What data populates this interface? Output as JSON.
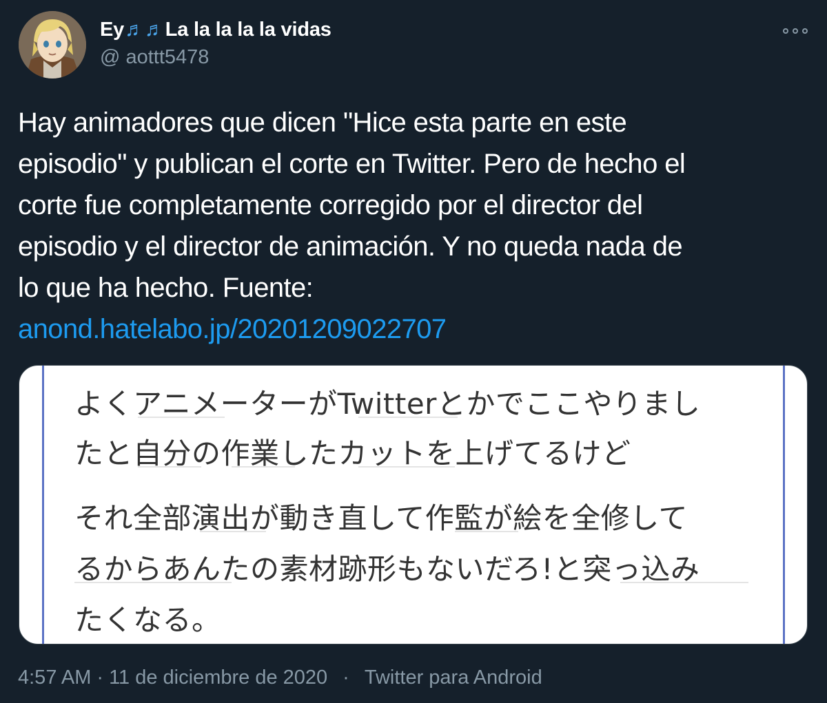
{
  "user": {
    "display_name_prefix": "Ey",
    "display_name_icon": "♬♬",
    "display_name_suffix": "La la la la la vidas",
    "handle": "@ aottt5478",
    "avatar_icon": "avatar-character-icon"
  },
  "menu": {
    "icon": "more-options-icon"
  },
  "tweet": {
    "lines": [
      "Hay animadores que dicen \"Hice esta parte en este",
      "episodio\" y publican el corte en Twitter. Pero de hecho el",
      "corte fue completamente corregido por el director del",
      "episodio y el director de animación. Y no queda nada de",
      "lo que ha hecho. Fuente:"
    ],
    "link": "anond.hatelabo.jp/20201209022707"
  },
  "media": {
    "lines": [
      "よくアニメーターがTwitterとかでここやりまし",
      "たと自分の作業したカットを上げてるけど",
      "それ全部演出が動き直して作監が絵を全修して",
      "るからあんたの素材跡形もないだろ!と突っ込み",
      "たくなる。"
    ]
  },
  "meta": {
    "time": "4:57 AM",
    "dot1": "·",
    "date": "11 de diciembre de 2020",
    "dot2": "·",
    "source": "Twitter para Android"
  },
  "colors": {
    "background": "#15202b",
    "link": "#1d9bf0",
    "secondary_text": "#8899a6",
    "music_icon": "#4aa3e8",
    "media_rule": "#5b72c4"
  }
}
